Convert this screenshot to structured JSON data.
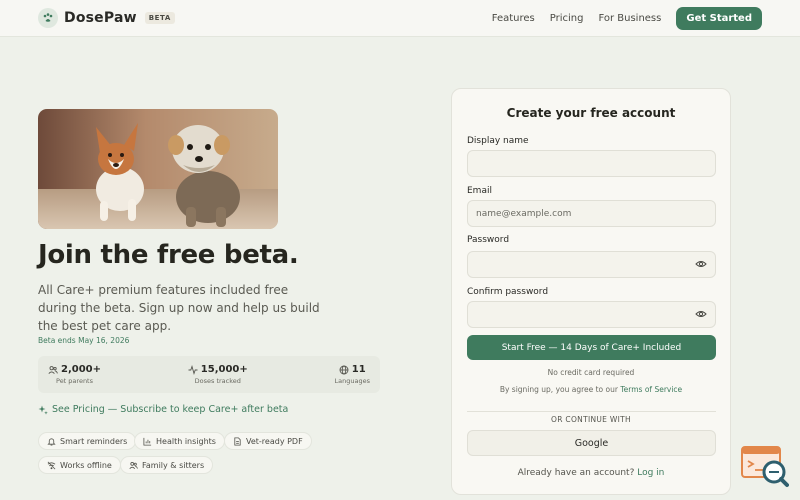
{
  "header": {
    "brand": "DosePaw",
    "badge": "BETA",
    "nav": [
      "Features",
      "Pricing",
      "For Business"
    ],
    "cta": "Get Started"
  },
  "hero": {
    "title": "Join the free beta.",
    "subtitle": "All Care+ premium features included free during the beta. Sign up now and help us build the best pet care app.",
    "beta_ends": "Beta ends May 16, 2026"
  },
  "stats": [
    {
      "value": "2,000+",
      "label": "Pet parents",
      "icon": "users-icon"
    },
    {
      "value": "15,000+",
      "label": "Doses tracked",
      "icon": "activity-icon"
    },
    {
      "value": "11",
      "label": "Languages",
      "icon": "globe-icon"
    }
  ],
  "pricing_link": "See Pricing — Subscribe to keep Care+ after beta",
  "chips": [
    {
      "label": "Smart reminders",
      "icon": "bell-icon"
    },
    {
      "label": "Health insights",
      "icon": "chart-icon"
    },
    {
      "label": "Vet-ready PDF",
      "icon": "document-icon"
    },
    {
      "label": "Works offline",
      "icon": "wifi-off-icon"
    },
    {
      "label": "Family & sitters",
      "icon": "users-icon"
    }
  ],
  "form": {
    "title": "Create your free account",
    "display_name_label": "Display name",
    "display_name_value": "",
    "email_label": "Email",
    "email_placeholder": "name@example.com",
    "password_label": "Password",
    "confirm_label": "Confirm password",
    "submit": "Start Free — 14 Days of Care+ Included",
    "no_card": "No credit card required",
    "terms_prefix": "By signing up, you agree to our",
    "terms_link": "Terms of Service",
    "divider": "OR CONTINUE WITH",
    "google": "Google",
    "login_prefix": "Already have an account?",
    "login_link": "Log in"
  },
  "colors": {
    "accent": "#3f7b5e",
    "background": "#eef1ea",
    "card": "#f9f8f3"
  }
}
